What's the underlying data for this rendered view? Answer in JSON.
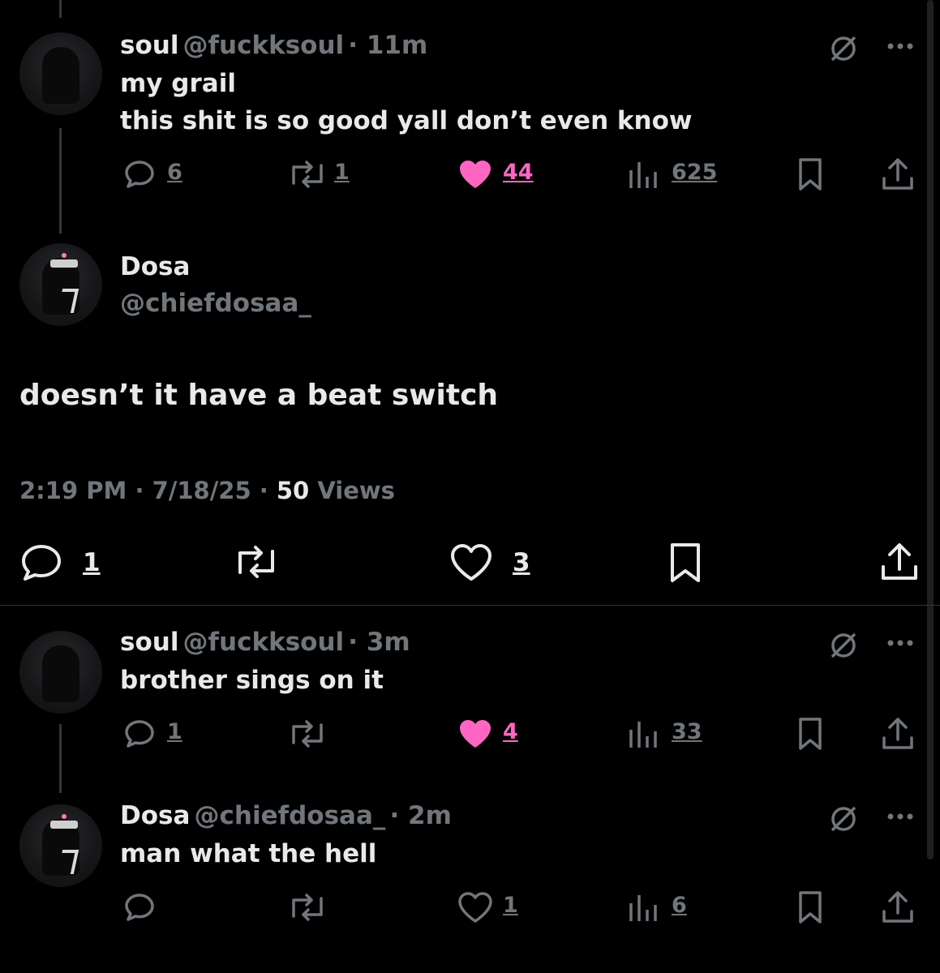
{
  "replies": [
    {
      "name": "soul",
      "handle": "@fuckksoul",
      "time": "· 11m",
      "text_lines": [
        "my grail",
        "this shit is so good yall don’t even know"
      ],
      "stats": {
        "replies": "6",
        "reposts": "1",
        "likes": "44",
        "views": "625"
      }
    },
    {
      "name": "soul",
      "handle": "@fuckksoul",
      "time": "· 3m",
      "text_lines": [
        "brother sings on it"
      ],
      "stats": {
        "replies": "1",
        "reposts": "",
        "likes": "4",
        "views": "33"
      }
    },
    {
      "name": "Dosa",
      "handle": "@chiefdosaa_",
      "time": "· 2m",
      "text_lines": [
        "man what the hell"
      ],
      "stats": {
        "replies": "",
        "reposts": "",
        "likes": "1",
        "views": "6"
      }
    }
  ],
  "focused": {
    "name": "Dosa",
    "handle": "@chiefdosaa_",
    "text": "doesn’t it have a beat switch",
    "time": "2:19 PM",
    "date": "· 7/18/25 ·",
    "views_count": "50",
    "views_label": "Views",
    "stats": {
      "replies": "1",
      "reposts": "",
      "likes": "3"
    }
  },
  "icons": {
    "reply": "speech-bubble-icon",
    "repost": "repost-arrows-icon",
    "like": "heart-icon",
    "views": "bar-chart-icon",
    "bookmark": "bookmark-icon",
    "share": "share-upload-icon",
    "grok": "grok-slash-circle-icon",
    "more": "more-dots-icon"
  },
  "colors": {
    "background": "#000000",
    "text": "#e7e9ea",
    "muted": "#71767b",
    "like_active": "#ff66c4"
  }
}
